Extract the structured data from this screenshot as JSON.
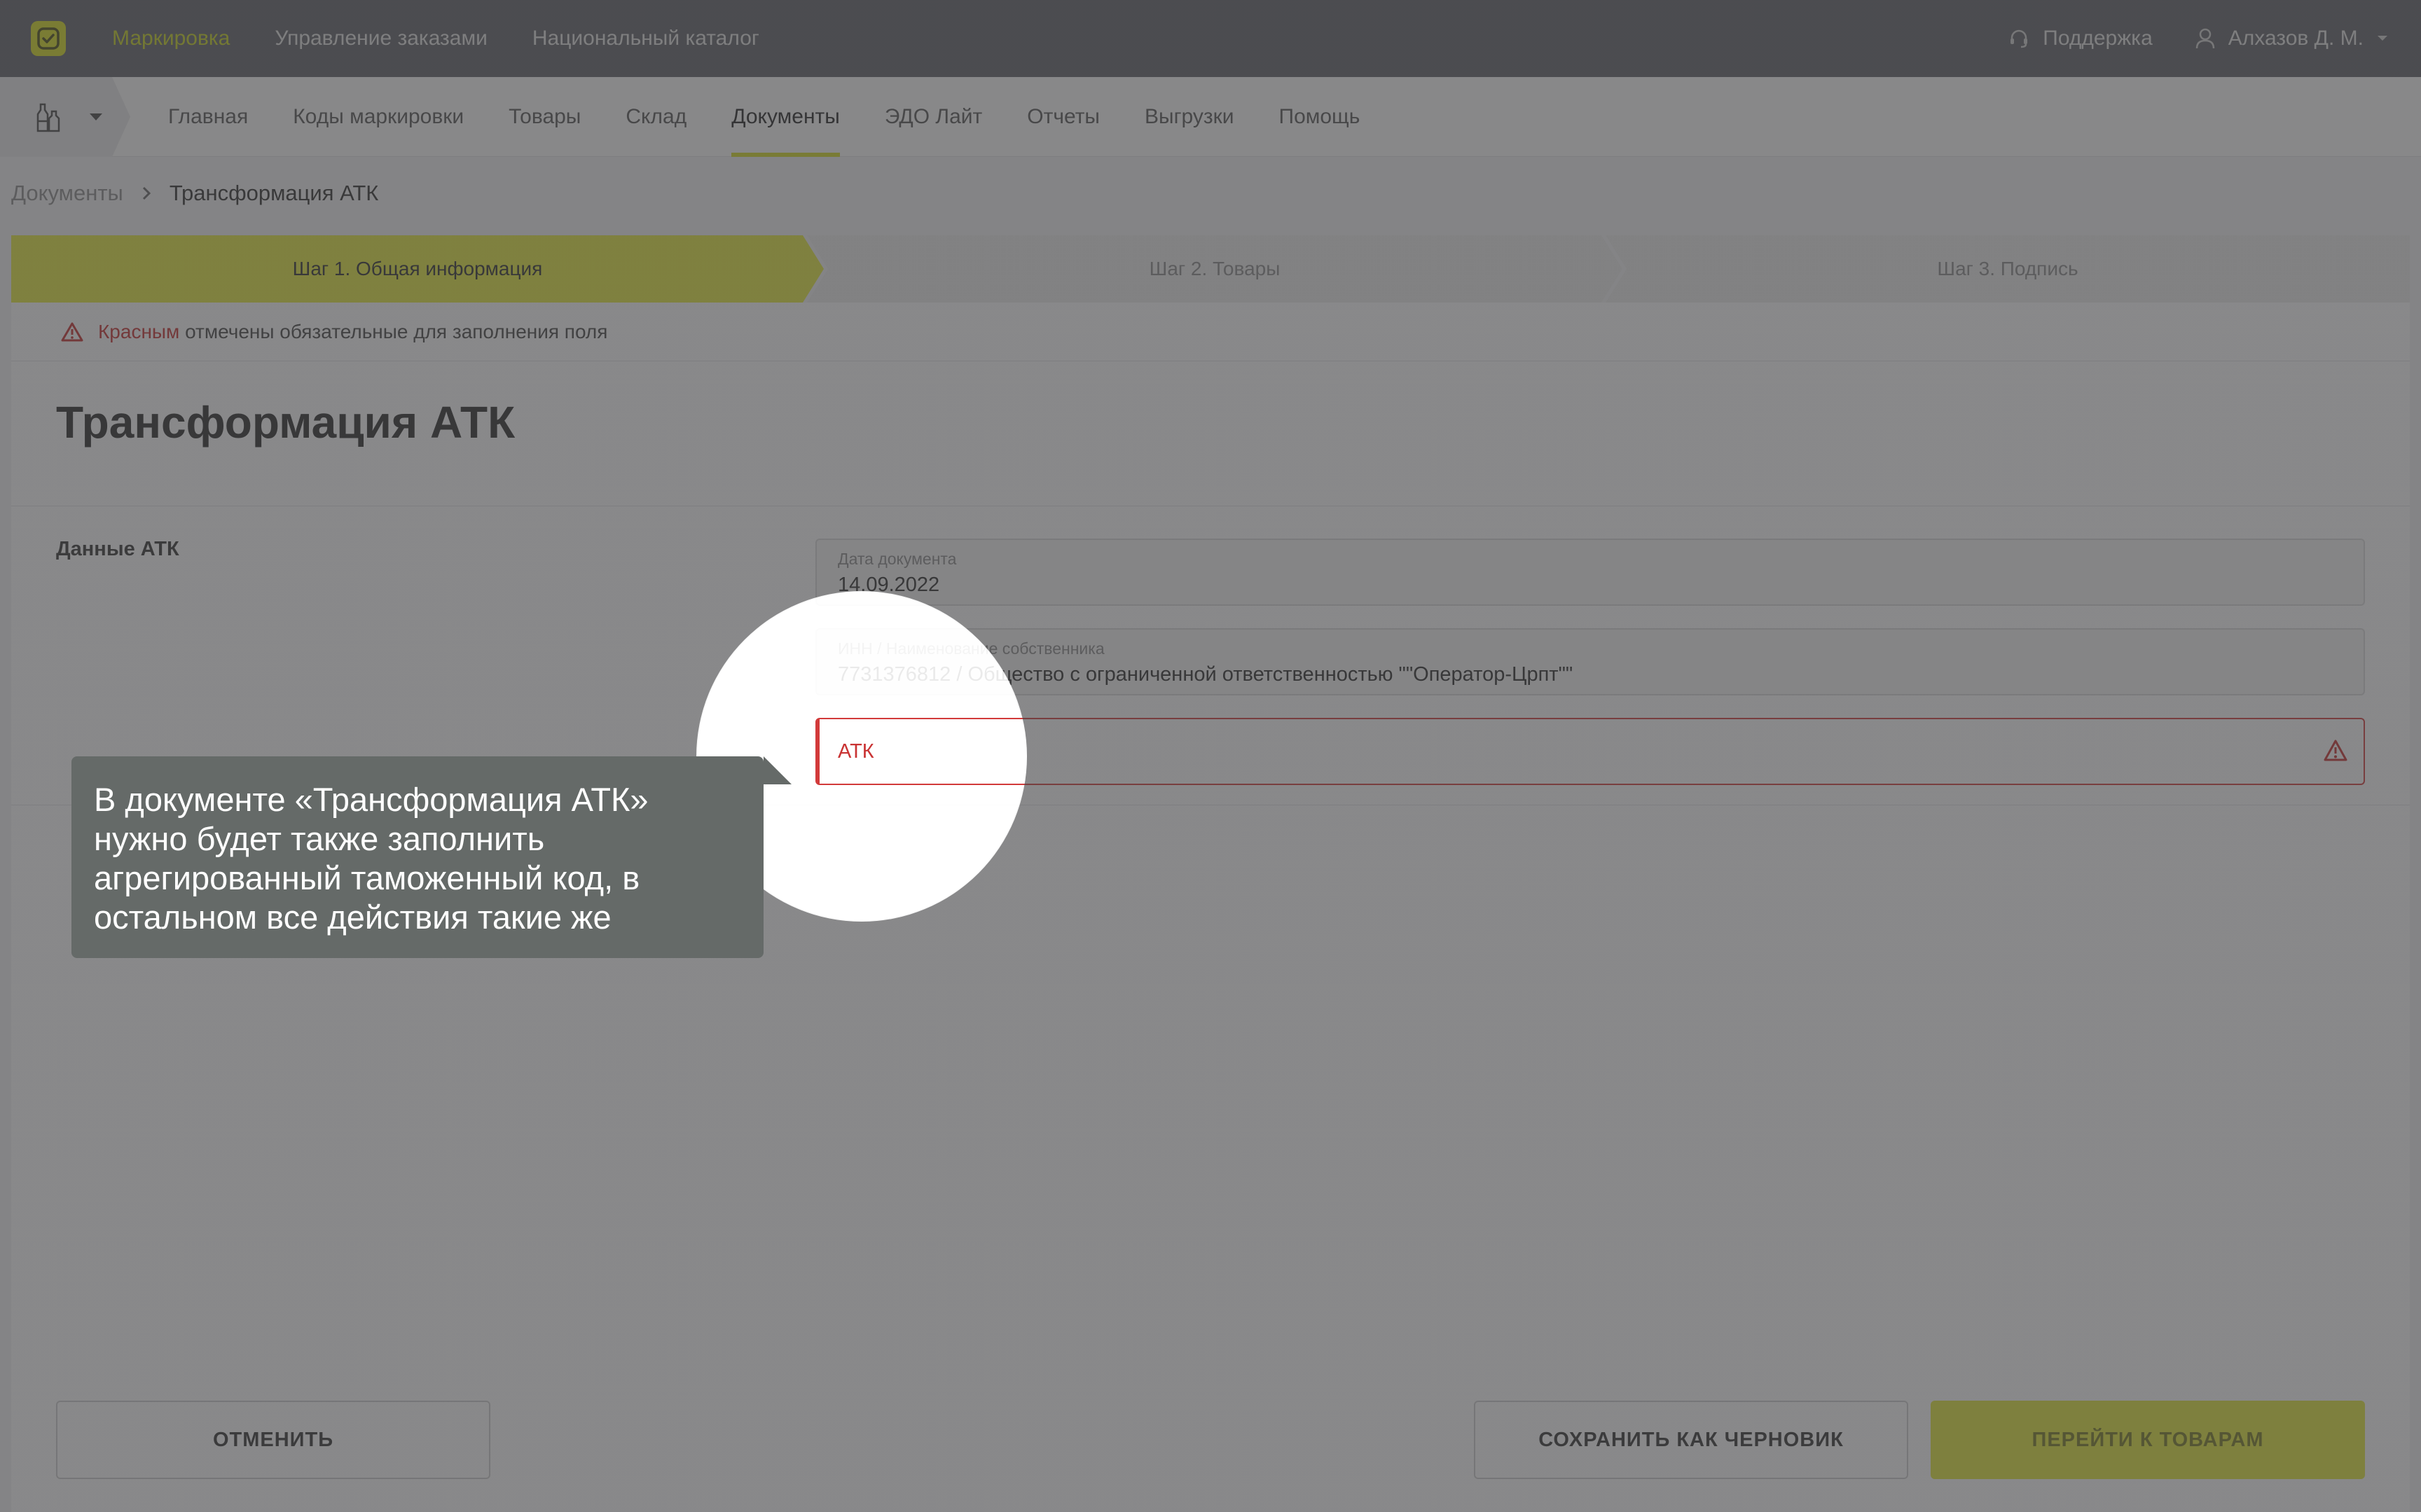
{
  "top_nav": {
    "items": [
      "Маркировка",
      "Управление заказами",
      "Национальный каталог"
    ],
    "active_index": 0,
    "support_label": "Поддержка",
    "user_name": "Алхазов Д. М."
  },
  "sub_nav": {
    "items": [
      "Главная",
      "Коды маркировки",
      "Товары",
      "Склад",
      "Документы",
      "ЭДО Лайт",
      "Отчеты",
      "Выгрузки",
      "Помощь"
    ],
    "active_index": 4
  },
  "breadcrumb": {
    "parent": "Документы",
    "current": "Трансформация АТК"
  },
  "steps": [
    "Шаг 1. Общая информация",
    "Шаг 2. Товары",
    "Шаг 3. Подпись"
  ],
  "notice": {
    "highlight": "Красным",
    "text": " отмечены обязательные для заполнения поля"
  },
  "form": {
    "title": "Трансформация АТК",
    "section_label": "Данные АТК",
    "date_label": "Дата документа",
    "date_value": "14.09.2022",
    "owner_label": "ИНН / Наименование собственника",
    "owner_value": "7731376812 / Общество с ограниченной ответственностью \"\"Оператор-Црпт\"\"",
    "atk_placeholder": "АТК"
  },
  "buttons": {
    "cancel": "ОТМЕНИТЬ",
    "save_draft": "СОХРАНИТЬ КАК ЧЕРНОВИК",
    "next": "ПЕРЕЙТИ К ТОВАРАМ"
  },
  "tooltip": {
    "text": "В документе «Трансформация АТК» нужно будет также заполнить агрегированный таможенный код, в остальном все действия такие же"
  },
  "colors": {
    "accent": "#d8df1e",
    "error": "#d23a3a",
    "topbar": "#5e6066"
  }
}
